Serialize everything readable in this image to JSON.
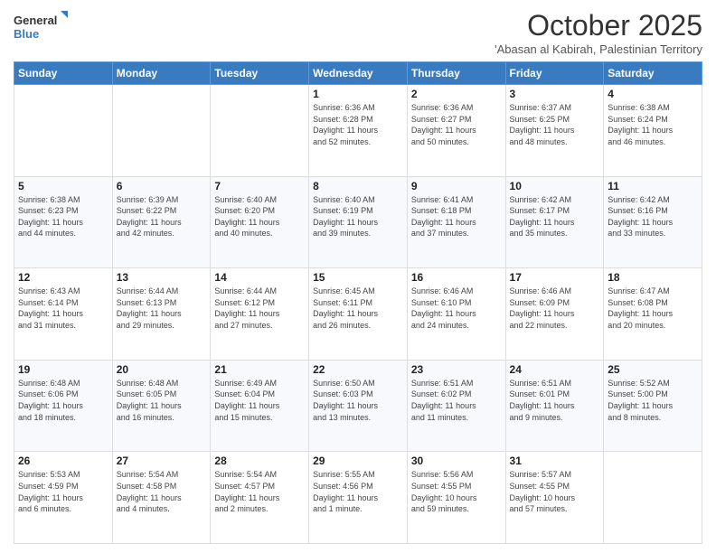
{
  "logo": {
    "line1": "General",
    "line2": "Blue"
  },
  "title": "October 2025",
  "subtitle": "'Abasan al Kabirah, Palestinian Territory",
  "weekdays": [
    "Sunday",
    "Monday",
    "Tuesday",
    "Wednesday",
    "Thursday",
    "Friday",
    "Saturday"
  ],
  "weeks": [
    [
      {
        "day": "",
        "info": ""
      },
      {
        "day": "",
        "info": ""
      },
      {
        "day": "",
        "info": ""
      },
      {
        "day": "1",
        "info": "Sunrise: 6:36 AM\nSunset: 6:28 PM\nDaylight: 11 hours\nand 52 minutes."
      },
      {
        "day": "2",
        "info": "Sunrise: 6:36 AM\nSunset: 6:27 PM\nDaylight: 11 hours\nand 50 minutes."
      },
      {
        "day": "3",
        "info": "Sunrise: 6:37 AM\nSunset: 6:25 PM\nDaylight: 11 hours\nand 48 minutes."
      },
      {
        "day": "4",
        "info": "Sunrise: 6:38 AM\nSunset: 6:24 PM\nDaylight: 11 hours\nand 46 minutes."
      }
    ],
    [
      {
        "day": "5",
        "info": "Sunrise: 6:38 AM\nSunset: 6:23 PM\nDaylight: 11 hours\nand 44 minutes."
      },
      {
        "day": "6",
        "info": "Sunrise: 6:39 AM\nSunset: 6:22 PM\nDaylight: 11 hours\nand 42 minutes."
      },
      {
        "day": "7",
        "info": "Sunrise: 6:40 AM\nSunset: 6:20 PM\nDaylight: 11 hours\nand 40 minutes."
      },
      {
        "day": "8",
        "info": "Sunrise: 6:40 AM\nSunset: 6:19 PM\nDaylight: 11 hours\nand 39 minutes."
      },
      {
        "day": "9",
        "info": "Sunrise: 6:41 AM\nSunset: 6:18 PM\nDaylight: 11 hours\nand 37 minutes."
      },
      {
        "day": "10",
        "info": "Sunrise: 6:42 AM\nSunset: 6:17 PM\nDaylight: 11 hours\nand 35 minutes."
      },
      {
        "day": "11",
        "info": "Sunrise: 6:42 AM\nSunset: 6:16 PM\nDaylight: 11 hours\nand 33 minutes."
      }
    ],
    [
      {
        "day": "12",
        "info": "Sunrise: 6:43 AM\nSunset: 6:14 PM\nDaylight: 11 hours\nand 31 minutes."
      },
      {
        "day": "13",
        "info": "Sunrise: 6:44 AM\nSunset: 6:13 PM\nDaylight: 11 hours\nand 29 minutes."
      },
      {
        "day": "14",
        "info": "Sunrise: 6:44 AM\nSunset: 6:12 PM\nDaylight: 11 hours\nand 27 minutes."
      },
      {
        "day": "15",
        "info": "Sunrise: 6:45 AM\nSunset: 6:11 PM\nDaylight: 11 hours\nand 26 minutes."
      },
      {
        "day": "16",
        "info": "Sunrise: 6:46 AM\nSunset: 6:10 PM\nDaylight: 11 hours\nand 24 minutes."
      },
      {
        "day": "17",
        "info": "Sunrise: 6:46 AM\nSunset: 6:09 PM\nDaylight: 11 hours\nand 22 minutes."
      },
      {
        "day": "18",
        "info": "Sunrise: 6:47 AM\nSunset: 6:08 PM\nDaylight: 11 hours\nand 20 minutes."
      }
    ],
    [
      {
        "day": "19",
        "info": "Sunrise: 6:48 AM\nSunset: 6:06 PM\nDaylight: 11 hours\nand 18 minutes."
      },
      {
        "day": "20",
        "info": "Sunrise: 6:48 AM\nSunset: 6:05 PM\nDaylight: 11 hours\nand 16 minutes."
      },
      {
        "day": "21",
        "info": "Sunrise: 6:49 AM\nSunset: 6:04 PM\nDaylight: 11 hours\nand 15 minutes."
      },
      {
        "day": "22",
        "info": "Sunrise: 6:50 AM\nSunset: 6:03 PM\nDaylight: 11 hours\nand 13 minutes."
      },
      {
        "day": "23",
        "info": "Sunrise: 6:51 AM\nSunset: 6:02 PM\nDaylight: 11 hours\nand 11 minutes."
      },
      {
        "day": "24",
        "info": "Sunrise: 6:51 AM\nSunset: 6:01 PM\nDaylight: 11 hours\nand 9 minutes."
      },
      {
        "day": "25",
        "info": "Sunrise: 5:52 AM\nSunset: 5:00 PM\nDaylight: 11 hours\nand 8 minutes."
      }
    ],
    [
      {
        "day": "26",
        "info": "Sunrise: 5:53 AM\nSunset: 4:59 PM\nDaylight: 11 hours\nand 6 minutes."
      },
      {
        "day": "27",
        "info": "Sunrise: 5:54 AM\nSunset: 4:58 PM\nDaylight: 11 hours\nand 4 minutes."
      },
      {
        "day": "28",
        "info": "Sunrise: 5:54 AM\nSunset: 4:57 PM\nDaylight: 11 hours\nand 2 minutes."
      },
      {
        "day": "29",
        "info": "Sunrise: 5:55 AM\nSunset: 4:56 PM\nDaylight: 11 hours\nand 1 minute."
      },
      {
        "day": "30",
        "info": "Sunrise: 5:56 AM\nSunset: 4:55 PM\nDaylight: 10 hours\nand 59 minutes."
      },
      {
        "day": "31",
        "info": "Sunrise: 5:57 AM\nSunset: 4:55 PM\nDaylight: 10 hours\nand 57 minutes."
      },
      {
        "day": "",
        "info": ""
      }
    ]
  ]
}
